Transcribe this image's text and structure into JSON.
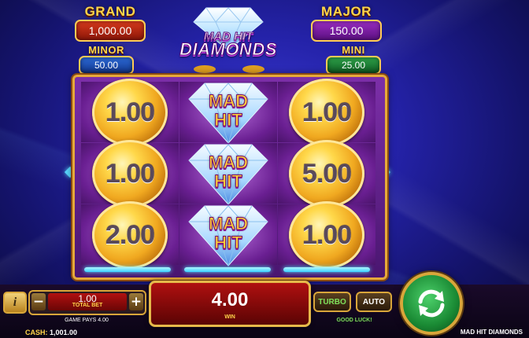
{
  "game": {
    "title": "MAD HIT DIAMONDS"
  },
  "logo": {
    "line1": "MAD HIT",
    "line2": "DIAMONDS"
  },
  "jackpots": {
    "grand": {
      "label": "GRAND",
      "value": "1,000.00"
    },
    "major": {
      "label": "MAJOR",
      "value": "150.00"
    },
    "minor": {
      "label": "MINOR",
      "value": "50.00"
    },
    "mini": {
      "label": "MINI",
      "value": "25.00"
    }
  },
  "reels": [
    {
      "symbols": [
        {
          "type": "coin",
          "value": "1.00"
        },
        {
          "type": "coin",
          "value": "1.00"
        },
        {
          "type": "coin",
          "value": "2.00"
        }
      ]
    },
    {
      "symbols": [
        {
          "type": "gem",
          "line1": "MAD",
          "line2": "HIT"
        },
        {
          "type": "gem",
          "line1": "MAD",
          "line2": "HIT"
        },
        {
          "type": "gem",
          "line1": "MAD",
          "line2": "HIT"
        }
      ]
    },
    {
      "symbols": [
        {
          "type": "coin",
          "value": "1.00"
        },
        {
          "type": "coin",
          "value": "5.00"
        },
        {
          "type": "coin",
          "value": "1.00"
        }
      ]
    }
  ],
  "controls": {
    "info_label": "i",
    "minus_label": "−",
    "plus_label": "+",
    "bet_value": "1.00",
    "bet_label": "TOTAL BET",
    "game_pays": "GAME PAYS 4.00",
    "win_value": "4.00",
    "win_label": "WIN",
    "turbo_label": "TURBO",
    "auto_label": "AUTO",
    "good_luck": "GOOD LUCK!"
  },
  "footer": {
    "cash_label": "CASH:",
    "cash_value": "1,001.00"
  },
  "colors": {
    "accent_gold": "#ffd54a",
    "spin_green": "#1a8a34",
    "win_red": "#b01010"
  }
}
